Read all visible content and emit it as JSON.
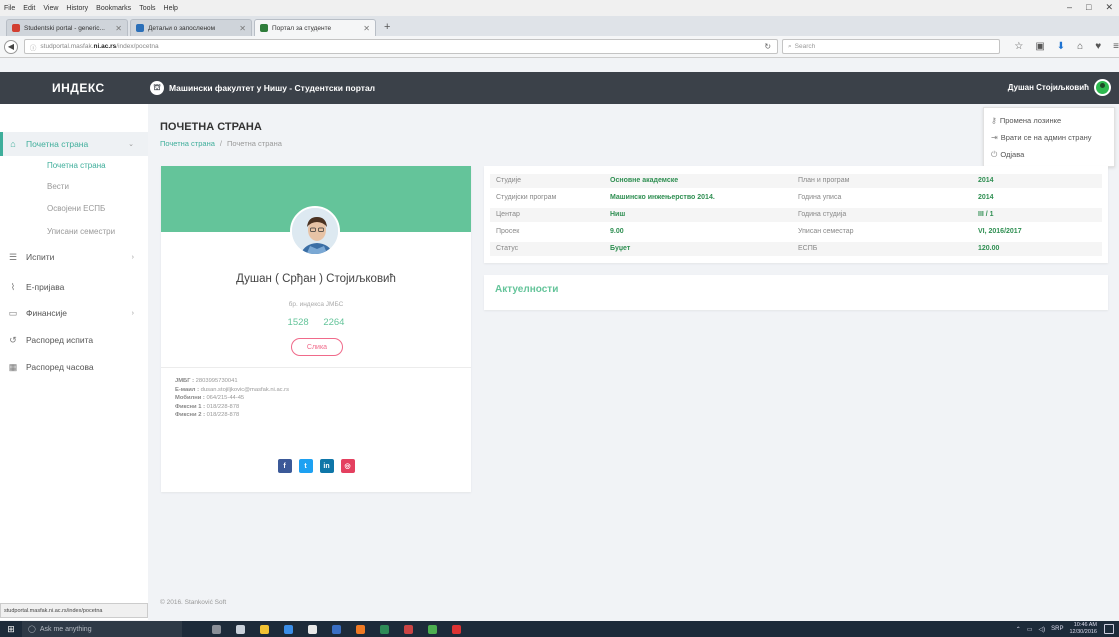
{
  "browser": {
    "menu": [
      "File",
      "Edit",
      "View",
      "History",
      "Bookmarks",
      "Tools",
      "Help"
    ],
    "tabs": [
      {
        "label": "Studentski portal - generic...",
        "active": false,
        "favicon_color": "#d23f31"
      },
      {
        "label": "Детаљи о запосленом",
        "active": false,
        "favicon_color": "#2b6fb8"
      },
      {
        "label": "Портал за студенте",
        "active": true,
        "favicon_color": "#2f7d3b"
      }
    ],
    "url_prefix": "studportal.masfak.",
    "url_host": "ni.ac.rs",
    "url_path": "/index/pocetna",
    "search_placeholder": "Search",
    "status_url": "studportal.masfak.ni.ac.rs/index/pocetna"
  },
  "app": {
    "brand": "ИНДЕКС",
    "title": "Машински факултет у Нишу - Студентски портал",
    "user_name": "Душан Стојиљковић"
  },
  "dropdown": {
    "items": [
      {
        "label": "Промена лозинке",
        "icon": "key-icon"
      },
      {
        "label": "Врати се на админ страну",
        "icon": "login-icon"
      },
      {
        "label": "Одјава",
        "icon": "power-icon"
      }
    ]
  },
  "sidebar": {
    "items": [
      {
        "label": "Почетна страна",
        "icon": "home-icon",
        "has_children": true,
        "active": true
      },
      {
        "label": "Испити",
        "icon": "list-icon",
        "has_children": true,
        "active": false
      },
      {
        "label": "Е-пријава",
        "icon": "rss-icon",
        "has_children": false,
        "active": false
      },
      {
        "label": "Финансије",
        "icon": "folder-icon",
        "has_children": true,
        "active": false
      },
      {
        "label": "Распоред испита",
        "icon": "calendar-icon",
        "has_children": false,
        "active": false
      },
      {
        "label": "Распоред часова",
        "icon": "grid-icon",
        "has_children": false,
        "active": false
      }
    ],
    "subitems": [
      {
        "label": "Почетна страна",
        "active": true
      },
      {
        "label": "Вести",
        "active": false
      },
      {
        "label": "Освојени ЕСПБ",
        "active": false
      },
      {
        "label": "Уписани семестри",
        "active": false
      }
    ]
  },
  "page": {
    "title": "ПОЧЕТНА СТРАНА",
    "breadcrumb": [
      "Почетна страна",
      "Почетна страна"
    ]
  },
  "profile": {
    "name": "Душан ( Срђан ) Стојиљковић",
    "meta": "бр. индекса  ЈМБС",
    "numbers": [
      "1528",
      "2264"
    ],
    "photo_button": "Слика",
    "contact": [
      {
        "label": "ЈМБГ :",
        "value": "2803995730041"
      },
      {
        "label": "E-маил :",
        "value": "dusan.stojiljkovic@masfak.ni.ac.rs"
      },
      {
        "label": "Мобилни :",
        "value": "064/215-44-45"
      },
      {
        "label": "Фиксни 1 :",
        "value": "018/228-878"
      },
      {
        "label": "Фиксни 2 :",
        "value": "018/228-878"
      }
    ],
    "socials": [
      {
        "label": "f",
        "color": "#3b5998",
        "name": "facebook-icon"
      },
      {
        "label": "t",
        "color": "#1da1f2",
        "name": "twitter-icon"
      },
      {
        "label": "in",
        "color": "#0e76a8",
        "name": "linkedin-icon"
      },
      {
        "label": "◎",
        "color": "#e4405f",
        "name": "instagram-icon"
      }
    ]
  },
  "info": {
    "rows": [
      {
        "l1": "Студије",
        "v1": "Основне академске",
        "l2": "План и програм",
        "v2": "2014"
      },
      {
        "l1": "Студијски програм",
        "v1": "Машинско инжењерство 2014.",
        "l2": "Година уписа",
        "v2": "2014"
      },
      {
        "l1": "Центар",
        "v1": "Ниш",
        "l2": "Година студија",
        "v2": "III / 1"
      },
      {
        "l1": "Просек",
        "v1": "9.00",
        "l2": "Уписан семестар",
        "v2": "VI, 2016/2017"
      },
      {
        "l1": "Статус",
        "v1": "Буџет",
        "l2": "ЕСПБ",
        "v2": "120.00"
      }
    ]
  },
  "news": {
    "title": "Актуелности"
  },
  "footer": {
    "text": "© 2016. Stanković Soft"
  },
  "taskbar": {
    "search_placeholder": "Ask me anything",
    "lang": "SRP",
    "time": "10:46 AM",
    "date": "12/30/2016"
  },
  "colors": {
    "accent": "#3fae9b",
    "cover": "#64c49a",
    "header": "#3b4149",
    "value_green": "#2f8f52"
  }
}
